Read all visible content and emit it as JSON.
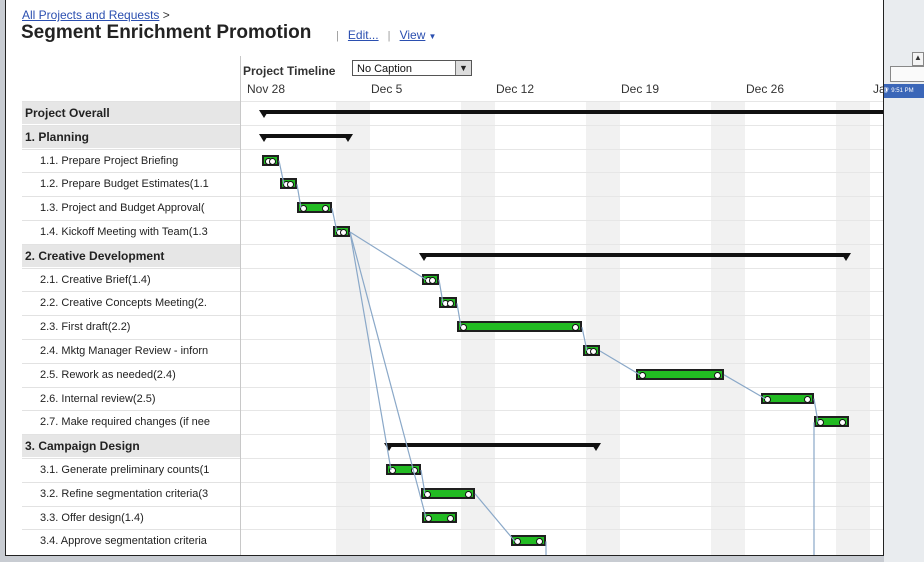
{
  "breadcrumb": {
    "link": "All Projects and Requests",
    "separator": ">"
  },
  "page": {
    "title": "Segment Enrichment Promotion",
    "edit_label": "Edit...",
    "view_label": "View",
    "pipe": "|"
  },
  "timeline": {
    "label": "Project Timeline",
    "caption_select": "No Caption",
    "dates": [
      "Nov 28",
      "Dec 5",
      "Dec 12",
      "Dec 19",
      "Dec 26",
      "Ja"
    ]
  },
  "rows": [
    {
      "label": "Project Overall",
      "type": "group"
    },
    {
      "label": "1. Planning",
      "type": "group"
    },
    {
      "label": "1.1. Prepare Project Briefing",
      "type": "task"
    },
    {
      "label": "1.2. Prepare Budget Estimates(1.1",
      "type": "task"
    },
    {
      "label": "1.3. Project and Budget Approval(",
      "type": "task"
    },
    {
      "label": "1.4. Kickoff Meeting with Team(1.3",
      "type": "task"
    },
    {
      "label": "2. Creative Development",
      "type": "group"
    },
    {
      "label": "2.1. Creative Brief(1.4)",
      "type": "task"
    },
    {
      "label": "2.2. Creative Concepts Meeting(2.",
      "type": "task"
    },
    {
      "label": "2.3. First draft(2.2)",
      "type": "task"
    },
    {
      "label": "2.4. Mktg Manager Review - inforn",
      "type": "task"
    },
    {
      "label": "2.5. Rework as needed(2.4)",
      "type": "task"
    },
    {
      "label": "2.6. Internal review(2.5)",
      "type": "task"
    },
    {
      "label": "2.7. Make required changes (if nee",
      "type": "task"
    },
    {
      "label": "3. Campaign Design",
      "type": "group"
    },
    {
      "label": "3.1. Generate preliminary counts(1",
      "type": "task"
    },
    {
      "label": "3.2. Refine segmentation criteria(3",
      "type": "task"
    },
    {
      "label": "3.3. Offer design(1.4)",
      "type": "task"
    },
    {
      "label": "3.4. Approve segmentation criteria",
      "type": "task"
    }
  ],
  "tray": {
    "time": "9:51 PM"
  },
  "colors": {
    "task_bar": "#22bb22",
    "summary_bar": "#111111",
    "link": "#2b4fb0",
    "weekend": "#f1f1f1"
  }
}
